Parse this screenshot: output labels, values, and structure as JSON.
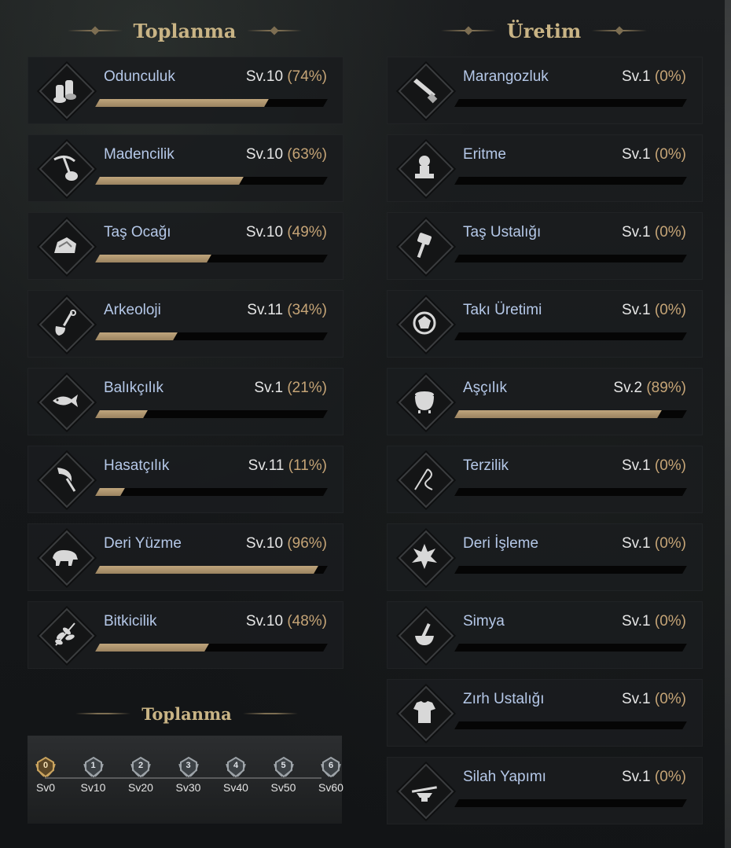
{
  "gathering": {
    "title": "Toplanma",
    "skills": [
      {
        "name": "Odunculuk",
        "level": "Sv.10",
        "pct": "(74%)",
        "progress": 74,
        "icon": "logs-icon"
      },
      {
        "name": "Madencilik",
        "level": "Sv.10",
        "pct": "(63%)",
        "progress": 63,
        "icon": "pickaxe-icon"
      },
      {
        "name": "Taş Ocağı",
        "level": "Sv.10",
        "pct": "(49%)",
        "progress": 49,
        "icon": "stone-icon"
      },
      {
        "name": "Arkeoloji",
        "level": "Sv.11",
        "pct": "(34%)",
        "progress": 34,
        "icon": "shovel-icon"
      },
      {
        "name": "Balıkçılık",
        "level": "Sv.1",
        "pct": "(21%)",
        "progress": 21,
        "icon": "fish-icon"
      },
      {
        "name": "Hasatçılık",
        "level": "Sv.11",
        "pct": "(11%)",
        "progress": 11,
        "icon": "sickle-icon"
      },
      {
        "name": "Deri Yüzme",
        "level": "Sv.10",
        "pct": "(96%)",
        "progress": 96,
        "icon": "boar-icon"
      },
      {
        "name": "Bitkicilik",
        "level": "Sv.10",
        "pct": "(48%)",
        "progress": 48,
        "icon": "herb-icon"
      }
    ]
  },
  "crafting": {
    "title": "Üretim",
    "skills": [
      {
        "name": "Marangozluk",
        "level": "Sv.1",
        "pct": "(0%)",
        "progress": 0,
        "icon": "saw-icon"
      },
      {
        "name": "Eritme",
        "level": "Sv.1",
        "pct": "(0%)",
        "progress": 0,
        "icon": "smelter-icon"
      },
      {
        "name": "Taş Ustalığı",
        "level": "Sv.1",
        "pct": "(0%)",
        "progress": 0,
        "icon": "hammer-icon"
      },
      {
        "name": "Takı Üretimi",
        "level": "Sv.1",
        "pct": "(0%)",
        "progress": 0,
        "icon": "gem-icon"
      },
      {
        "name": "Aşçılık",
        "level": "Sv.2",
        "pct": "(89%)",
        "progress": 89,
        "icon": "cauldron-icon"
      },
      {
        "name": "Terzilik",
        "level": "Sv.1",
        "pct": "(0%)",
        "progress": 0,
        "icon": "needle-icon"
      },
      {
        "name": "Deri İşleme",
        "level": "Sv.1",
        "pct": "(0%)",
        "progress": 0,
        "icon": "hide-icon"
      },
      {
        "name": "Simya",
        "level": "Sv.1",
        "pct": "(0%)",
        "progress": 0,
        "icon": "mortar-icon"
      },
      {
        "name": "Zırh Ustalığı",
        "level": "Sv.1",
        "pct": "(0%)",
        "progress": 0,
        "icon": "armor-icon"
      },
      {
        "name": "Silah Yapımı",
        "level": "Sv.1",
        "pct": "(0%)",
        "progress": 0,
        "icon": "anvil-sword-icon"
      }
    ]
  },
  "gathering_levels": {
    "title": "Toplanma",
    "badges": [
      {
        "num": "0",
        "label": "Sv0",
        "active": true
      },
      {
        "num": "1",
        "label": "Sv10",
        "active": false
      },
      {
        "num": "2",
        "label": "Sv20",
        "active": false
      },
      {
        "num": "3",
        "label": "Sv30",
        "active": false
      },
      {
        "num": "4",
        "label": "Sv40",
        "active": false
      },
      {
        "num": "5",
        "label": "Sv50",
        "active": false
      },
      {
        "num": "6",
        "label": "Sv60",
        "active": false
      }
    ]
  },
  "colors": {
    "title_gold": "#c9b485",
    "skill_name": "#b5c8e8",
    "percent": "#c5a476",
    "bar_fill": "#bfa57c"
  }
}
